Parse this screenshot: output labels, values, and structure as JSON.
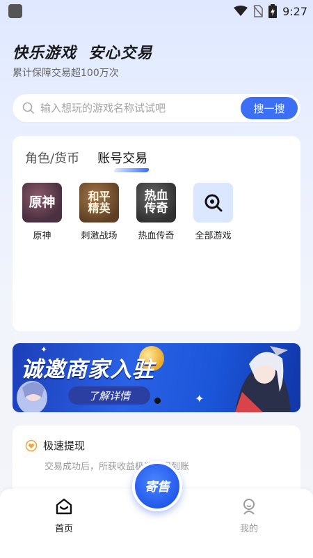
{
  "status_bar": {
    "time": "9:27",
    "icons": [
      "wifi-icon",
      "no-sim-icon",
      "battery-charging-icon"
    ]
  },
  "hero": {
    "title": "快乐游戏  安心交易",
    "subtitle": "累计保障交易超100万次"
  },
  "search": {
    "placeholder": "输入想玩的游戏名称试试吧",
    "button_label": "搜一搜"
  },
  "trade_card": {
    "tabs": [
      {
        "label": "角色/货币",
        "active": false
      },
      {
        "label": "账号交易",
        "active": true
      }
    ],
    "games": [
      {
        "tile_text": "原神",
        "label": "原神"
      },
      {
        "tile_text": "和平精英",
        "label": "刺激战场"
      },
      {
        "tile_text": "热血传奇",
        "label": "热血传奇"
      },
      {
        "tile_icon": "search-icon",
        "label": "全部游戏"
      }
    ]
  },
  "banner": {
    "title": "诚邀商家入驻",
    "button_label": "了解详情"
  },
  "features": [
    {
      "icon": "shield-heart-icon",
      "title": "极速提现",
      "desc": "交易成功后，所获收益极速提现到账"
    }
  ],
  "tabbar": {
    "items": [
      {
        "label": "首页",
        "icon": "home-icon",
        "active": true
      },
      {
        "label": "我的",
        "icon": "profile-icon",
        "active": false
      }
    ],
    "fab_label": "寄售"
  },
  "colors": {
    "accent": "#3d6ff4",
    "inactive": "#9a9a9a"
  }
}
